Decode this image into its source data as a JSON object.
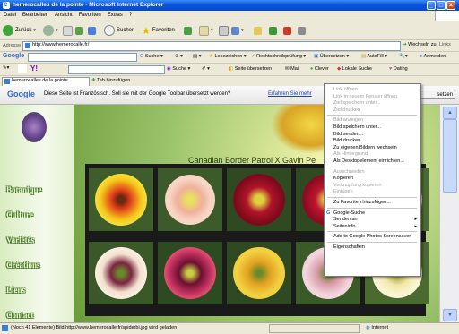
{
  "window": {
    "title": "hemerocalles de la pointe - Microsoft Internet Explorer"
  },
  "menu": [
    "Datei",
    "Bearbeiten",
    "Ansicht",
    "Favoriten",
    "Extras",
    "?"
  ],
  "toolbar": {
    "back": "Zurück",
    "search": "Suchen",
    "favorites": "Favoriten"
  },
  "address": {
    "label": "Adresse",
    "url": "http://www.hemerocalle.fr/",
    "go": "Wechseln zu",
    "links": "Links"
  },
  "google_toolbar": {
    "logo": "Google",
    "search": "Suche",
    "bookmarks": "Lesezeichen",
    "spellcheck": "Rechtschreibprüfung",
    "translate": "Übersetzen",
    "autofill": "AutoFill",
    "signin": "Anmelden"
  },
  "yahoo_toolbar": {
    "search": "Suche",
    "translate_page": "Seite übersetzen",
    "mail": "Mail",
    "clever": "Clever",
    "local_search": "Lokale Suche",
    "dating": "Dating"
  },
  "tabs": {
    "active": "hemerocalles de la pointe",
    "add": "Tab hinzufügen"
  },
  "translate_bar": {
    "logo": "Google",
    "message": "Diese Seite ist Französisch. Soll sie mit der Google Toolbar übersetzt werden?",
    "link": "Erfahren Sie mehr",
    "button": "setzen"
  },
  "page": {
    "nav": [
      "Botanique",
      "Culture",
      "Variétés",
      "Créations",
      "Liens",
      "Contact"
    ],
    "gallery_title": "Canadian Border Patrol X Gavin Pe"
  },
  "context_menu": {
    "items": [
      {
        "label": "Link öffnen",
        "enabled": false
      },
      {
        "label": "Link in neuem Fenster öffnen",
        "enabled": false
      },
      {
        "label": "Ziel speichern unter...",
        "enabled": false
      },
      {
        "label": "Ziel drucken",
        "enabled": false
      },
      {
        "sep": true
      },
      {
        "label": "Bild anzeigen",
        "enabled": false
      },
      {
        "label": "Bild speichern unter...",
        "enabled": true
      },
      {
        "label": "Bild senden...",
        "enabled": true
      },
      {
        "label": "Bild drucken...",
        "enabled": true
      },
      {
        "label": "Zu eigenen Bildern wechseln",
        "enabled": true
      },
      {
        "label": "Als Hintergrund",
        "enabled": false
      },
      {
        "label": "Als Desktopelement einrichten...",
        "enabled": true
      },
      {
        "sep": true
      },
      {
        "label": "Ausschneiden",
        "enabled": false
      },
      {
        "label": "Kopieren",
        "enabled": true
      },
      {
        "label": "Verknüpfung kopieren",
        "enabled": false
      },
      {
        "label": "Einfügen",
        "enabled": false
      },
      {
        "sep": true
      },
      {
        "label": "Zu Favoriten hinzufügen...",
        "enabled": true
      },
      {
        "sep": true
      },
      {
        "label": "Google-Suche",
        "enabled": true
      },
      {
        "label": "Senden an",
        "enabled": true,
        "submenu": true
      },
      {
        "label": "Seiteninfo",
        "enabled": true,
        "submenu": true
      },
      {
        "sep": true
      },
      {
        "label": "Add to Google Photos Screensaver",
        "enabled": true
      },
      {
        "sep": true
      },
      {
        "label": "Eigenschaften",
        "enabled": true
      }
    ]
  },
  "status": {
    "message": "(Noch 41 Elemente) Bild http://www.hemerocalle.fr/spiderbi.jpg wird geladen",
    "zone": "Internet"
  },
  "colors": {
    "titlebar": "#0a55de",
    "page_bg": "#b9d69a",
    "nav_text": "#e9f7d8"
  }
}
